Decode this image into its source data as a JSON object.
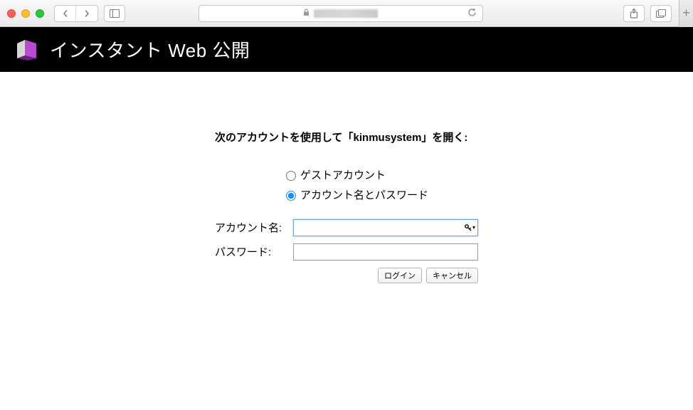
{
  "chrome": {
    "back": "‹",
    "forward": "›",
    "sidebar": "☐",
    "share": "⇪",
    "tabs": "⧉",
    "newtab": "+",
    "reload": "↻",
    "url_obscured": true
  },
  "header": {
    "title": "インスタント Web 公開"
  },
  "login": {
    "prompt": "次のアカウントを使用して「kinmusystem」を開く:",
    "radio_guest": "ゲストアカウント",
    "radio_account": "アカウント名とパスワード",
    "radio_selected": "account",
    "account_label": "アカウント名:",
    "account_value": "",
    "password_label": "パスワード:",
    "password_value": "",
    "login_button": "ログイン",
    "cancel_button": "キャンセル",
    "key_dropdown_icon": "▾"
  }
}
